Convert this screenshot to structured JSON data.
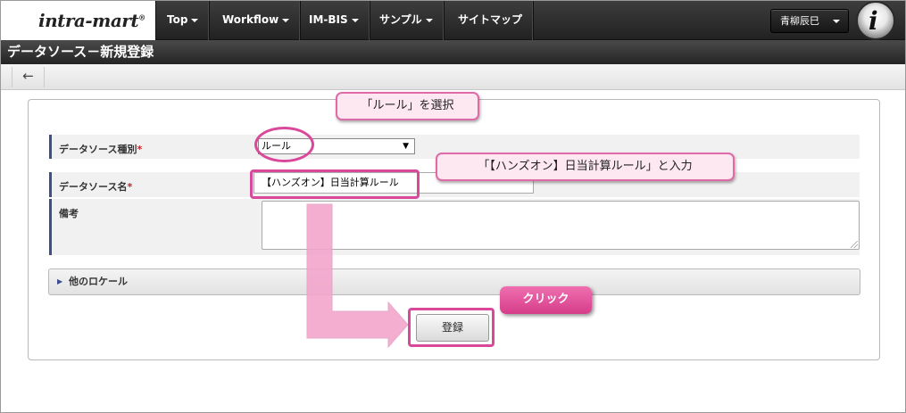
{
  "app": {
    "logo_text": "intra-mart",
    "logo_mark": "®"
  },
  "nav": {
    "items": [
      {
        "label": "Top",
        "has_menu": true
      },
      {
        "label": "Workflow",
        "has_menu": true
      },
      {
        "label": "IM-BIS",
        "has_menu": true
      },
      {
        "label": "サンプル",
        "has_menu": true
      },
      {
        "label": "サイトマップ",
        "has_menu": false
      }
    ],
    "user_name": "青柳辰巳"
  },
  "page": {
    "title": "データソース－新規登録"
  },
  "toolbar": {
    "back_icon": "←"
  },
  "form": {
    "type_label": "データソース種別",
    "type_required_mark": "*",
    "type_value": "ルール",
    "name_label": "データソース名",
    "name_required_mark": "*",
    "name_value": "【ハンズオン】日当計算ルール",
    "note_label": "備考",
    "note_value": "",
    "locale_label": "他のロケール",
    "submit_label": "登録"
  },
  "annotations": {
    "select_callout": "「ルール」を選択",
    "input_callout": "「【ハンズオン】日当計算ルール」と入力",
    "click_label": "クリック",
    "accent_color": "#d9489a",
    "arrow_color": "#f2a6cc"
  },
  "icons": {
    "dropdown": "caret-down-icon",
    "back": "arrow-left-icon",
    "expand": "triangle-right-icon",
    "user_avatar": "intra-mart-i-logo"
  }
}
